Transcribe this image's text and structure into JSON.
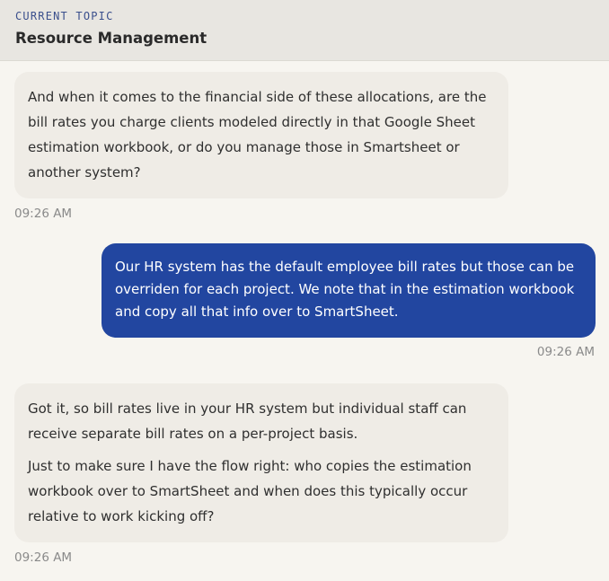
{
  "header": {
    "label": "CURRENT TOPIC",
    "title": "Resource Management"
  },
  "messages": [
    {
      "role": "assistant",
      "paragraphs": [
        "And when it comes to the financial side of these allocations, are the bill rates you charge clients modeled directly in that Google Sheet estimation workbook, or do you manage those in Smartsheet or another system?"
      ],
      "time": "09:26 AM"
    },
    {
      "role": "user",
      "paragraphs": [
        "Our HR system has the default employee bill rates but those can be overriden for each project. We note that in the estimation workbook and copy all that info over to SmartSheet."
      ],
      "time": "09:26 AM"
    },
    {
      "role": "assistant",
      "paragraphs": [
        "Got it, so bill rates live in your HR system but individual staff can receive separate bill rates on a per-project basis.",
        "Just to make sure I have the flow right: who copies the estimation workbook over to SmartSheet and when does this typically occur relative to work kicking off?"
      ],
      "time": "09:26 AM"
    }
  ],
  "colors": {
    "background": "#f7f5f0",
    "header_bg": "#e8e6e1",
    "assistant_bubble": "#efece6",
    "user_bubble": "#2246a0",
    "label_accent": "#3a4f8c",
    "timestamp": "#8a8a8a"
  }
}
